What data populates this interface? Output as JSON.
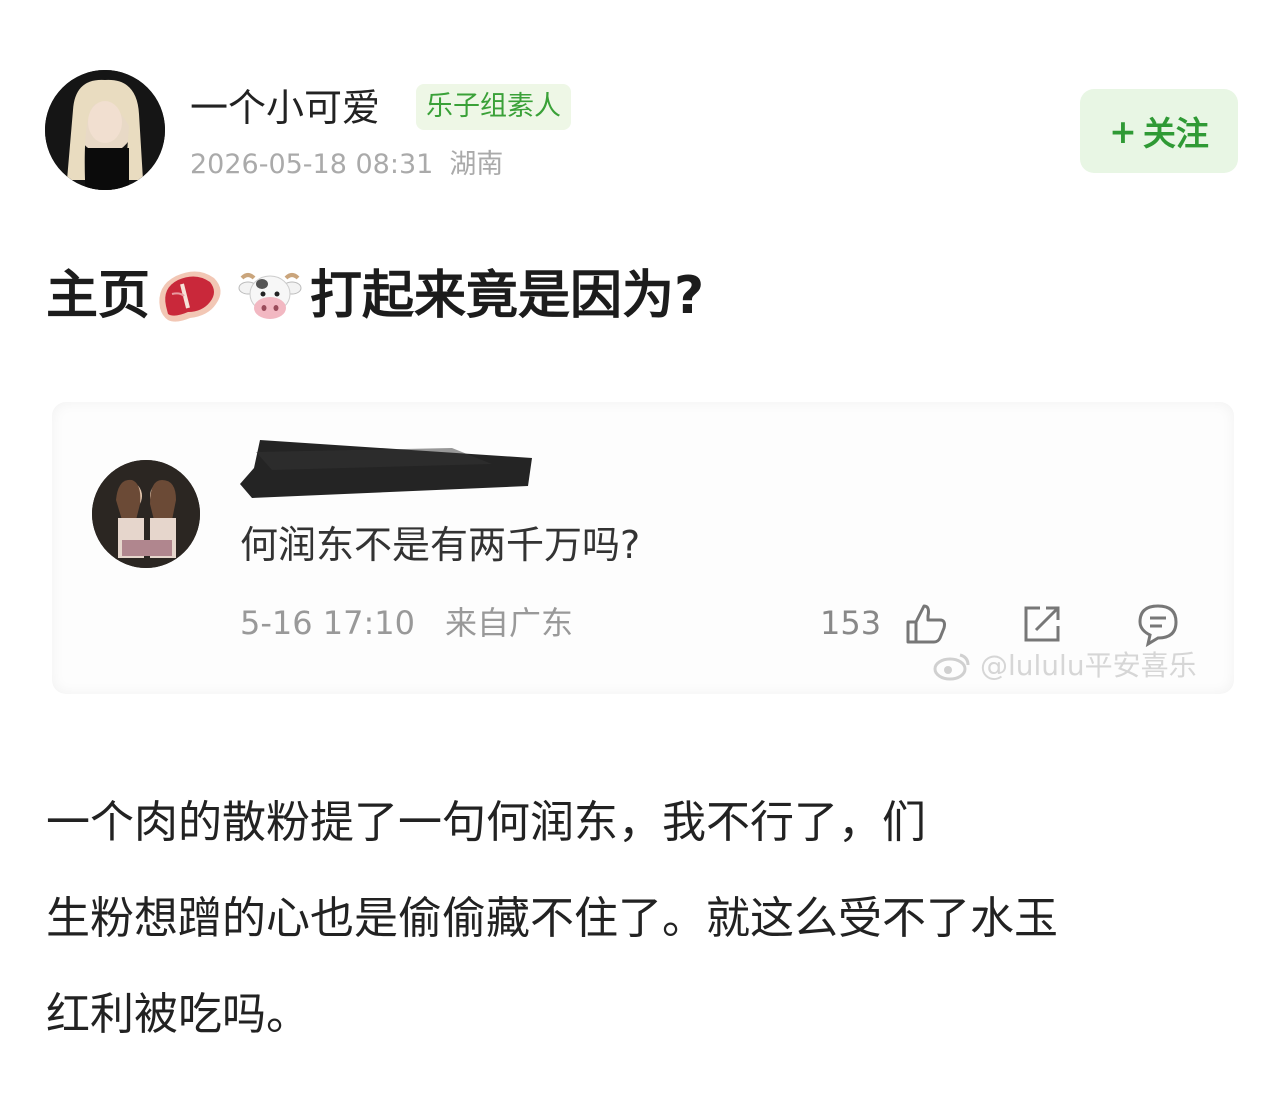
{
  "author": {
    "name": "一个小可爱",
    "badge": "乐子组素人",
    "date": "2026-05-18 08:31",
    "location": "湖南",
    "follow_label": "关注",
    "follow_plus": "+"
  },
  "post": {
    "title_prefix": "主页",
    "title_suffix": "打起来竟是因为?",
    "title_emojis": [
      "meat-emoji",
      "cow-emoji"
    ],
    "body_lines": [
      "一个肉的散粉提了一句何润东，我不行了，们",
      "生粉想蹭的心也是偷偷藏不住了。就这么受不了水玉",
      "红利被吃吗。"
    ]
  },
  "embedded_comment": {
    "text": "何润东不是有两千万吗?",
    "date": "5-16 17:10",
    "source": "来自广东",
    "likes": "153",
    "icons": [
      "thumbs-up-icon",
      "share-icon",
      "comment-icon"
    ],
    "watermark": "@lululu平安喜乐"
  },
  "colors": {
    "accent_green": "#2f9a35",
    "badge_bg": "#eef7e6",
    "follow_bg": "#e8f6e4"
  }
}
